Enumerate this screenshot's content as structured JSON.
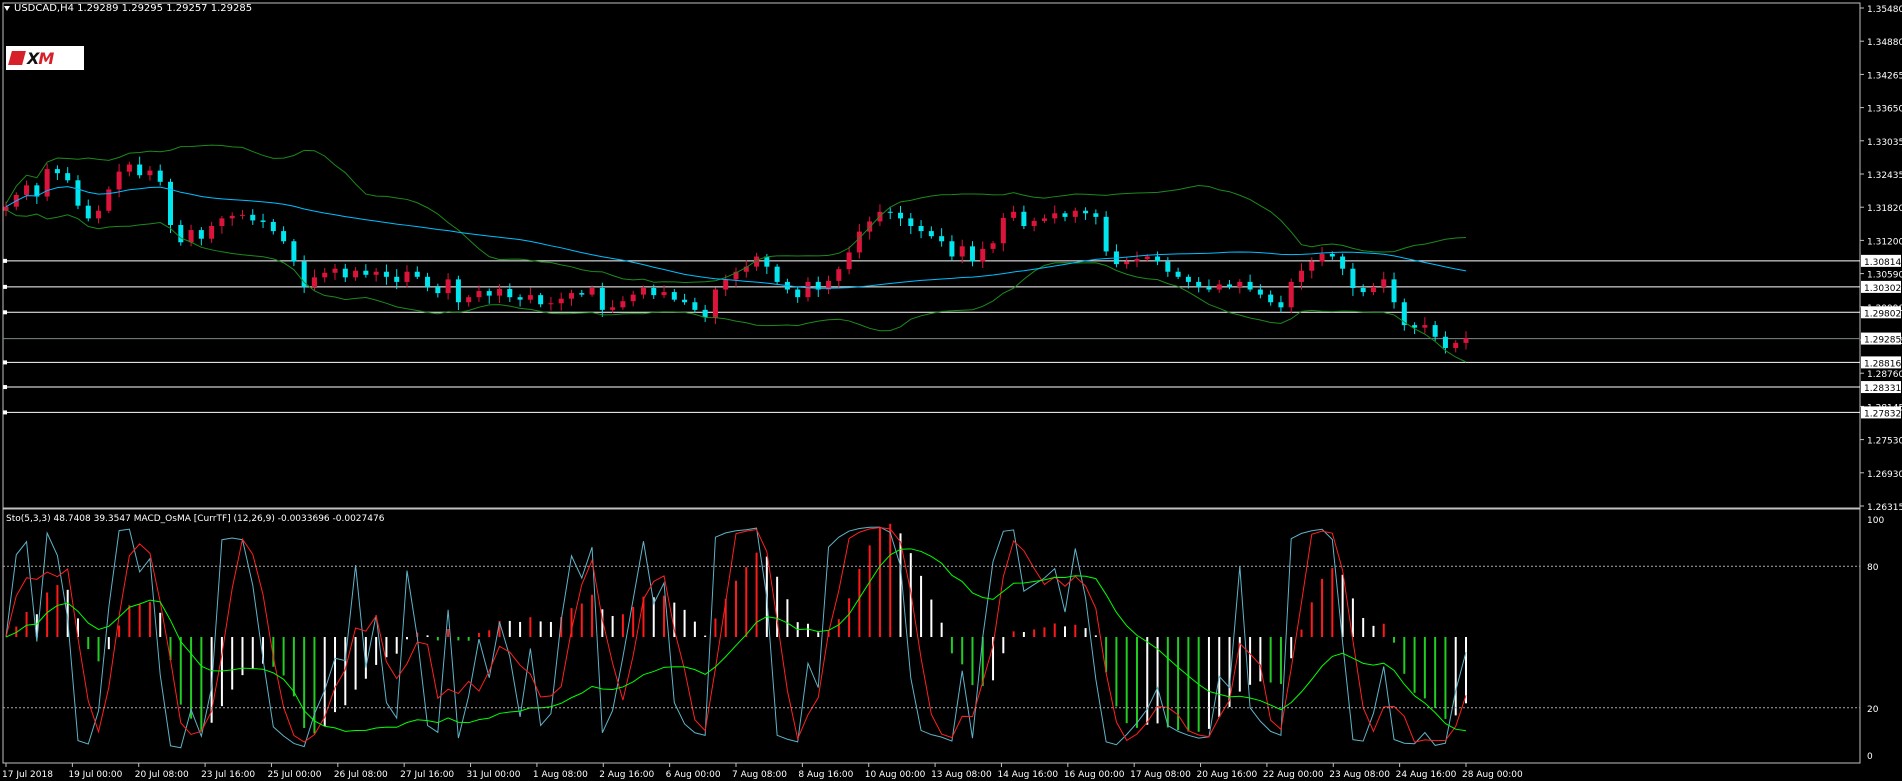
{
  "header": {
    "symbol_line": "USDCAD,H4  1.29289 1.29295 1.29257 1.29285"
  },
  "indicator_header": {
    "text": "Sto(5,3,3) 48.7408 39.3547   MACD_OsMA [CurrTF] (12,26,9) -0.0033696 -0.0027476"
  },
  "logo": {
    "text_left": "X",
    "text_right": "M"
  },
  "colors": {
    "background": "#000000",
    "bull_candle": "#dc143c",
    "bear_candle": "#00e5ee",
    "ma_fast": "#00bfff",
    "bands": "#1c8a1c",
    "sto_main": "#5fb3c8",
    "sto_signal": "#ff2020",
    "macd_pos": "#ff1a1a",
    "macd_neg": "#22cc22",
    "macd_white": "#ffffff",
    "osma_line": "#00ff00",
    "hline": "#ffffff",
    "grid": "#c0c0c0"
  },
  "price_axis": {
    "labels": [
      "1.35480",
      "1.34880",
      "1.34265",
      "1.33650",
      "1.33035",
      "1.32435",
      "1.31820",
      "1.31200",
      "1.30590",
      "1.29990",
      "1.29375",
      "1.28760",
      "1.28145",
      "1.27530",
      "1.26930",
      "1.26315"
    ],
    "highlighted": [
      "1.30814",
      "1.30302",
      "1.29802",
      "1.29285",
      "1.28816",
      "1.28331",
      "1.27832"
    ],
    "current": "1.29285"
  },
  "indicator_axis": {
    "labels": [
      "100",
      "80",
      "20",
      "0"
    ]
  },
  "time_axis": {
    "labels": [
      "17 Jul 2018",
      "19 Jul 00:00",
      "20 Jul 08:00",
      "23 Jul 16:00",
      "25 Jul 00:00",
      "26 Jul 08:00",
      "27 Jul 16:00",
      "31 Jul 00:00",
      "1 Aug 08:00",
      "2 Aug 16:00",
      "6 Aug 00:00",
      "7 Aug 08:00",
      "8 Aug 16:00",
      "10 Aug 00:00",
      "13 Aug 08:00",
      "14 Aug 16:00",
      "16 Aug 00:00",
      "17 Aug 08:00",
      "20 Aug 16:00",
      "22 Aug 00:00",
      "23 Aug 08:00",
      "24 Aug 16:00",
      "28 Aug 00:00"
    ]
  },
  "chart_data": {
    "type": "candlestick",
    "price_range": [
      1.2601,
      1.3579
    ],
    "horizontal_levels": [
      1.30814,
      1.30302,
      1.29802,
      1.28816,
      1.28331,
      1.27832
    ],
    "close_series": [
      1.3188,
      1.3211,
      1.323,
      1.3208,
      1.3262,
      1.3254,
      1.324,
      1.319,
      1.3165,
      1.318,
      1.3222,
      1.3257,
      1.3271,
      1.325,
      1.3259,
      1.3237,
      1.3152,
      1.3118,
      1.3142,
      1.3125,
      1.315,
      1.3165,
      1.317,
      1.3172,
      1.3161,
      1.3158,
      1.314,
      1.312,
      1.308,
      1.303,
      1.3049,
      1.3058,
      1.3066,
      1.3049,
      1.3062,
      1.3054,
      1.306,
      1.305,
      1.304,
      1.306,
      1.305,
      1.303,
      1.3018,
      1.3045,
      1.3,
      1.301,
      1.3022,
      1.3013,
      1.3026,
      1.301,
      1.3005,
      1.3014,
      1.2996,
      1.2998,
      1.3007,
      1.3018,
      1.3015,
      1.3028,
      1.2985,
      1.299,
      1.3002,
      1.3015,
      1.3028,
      1.3014,
      1.302,
      1.3005,
      1.3,
      1.2985,
      1.297,
      1.3025,
      1.3045,
      1.306,
      1.307,
      1.309,
      1.307,
      1.304,
      1.3025,
      1.301,
      1.304,
      1.3025,
      1.3042,
      1.3065,
      1.3098,
      1.3139,
      1.3159,
      1.3178,
      1.3176,
      1.3165,
      1.315,
      1.314,
      1.313,
      1.312,
      1.309,
      1.311,
      1.308,
      1.3105,
      1.3116,
      1.3166,
      1.3178,
      1.315,
      1.316,
      1.3165,
      1.3175,
      1.3168,
      1.318,
      1.3175,
      1.3168,
      1.31,
      1.3075,
      1.308,
      1.3085,
      1.309,
      1.308,
      1.306,
      1.305,
      1.304,
      1.303,
      1.3025,
      1.3035,
      1.303,
      1.304,
      1.3025,
      1.3015,
      1.3,
      1.299,
      1.304,
      1.3062,
      1.308,
      1.3095,
      1.309,
      1.3066,
      1.3028,
      1.302,
      1.303,
      1.3045,
      1.3,
      1.2955,
      1.295,
      1.2955,
      1.2932,
      1.291,
      1.292,
      1.2929
    ]
  }
}
